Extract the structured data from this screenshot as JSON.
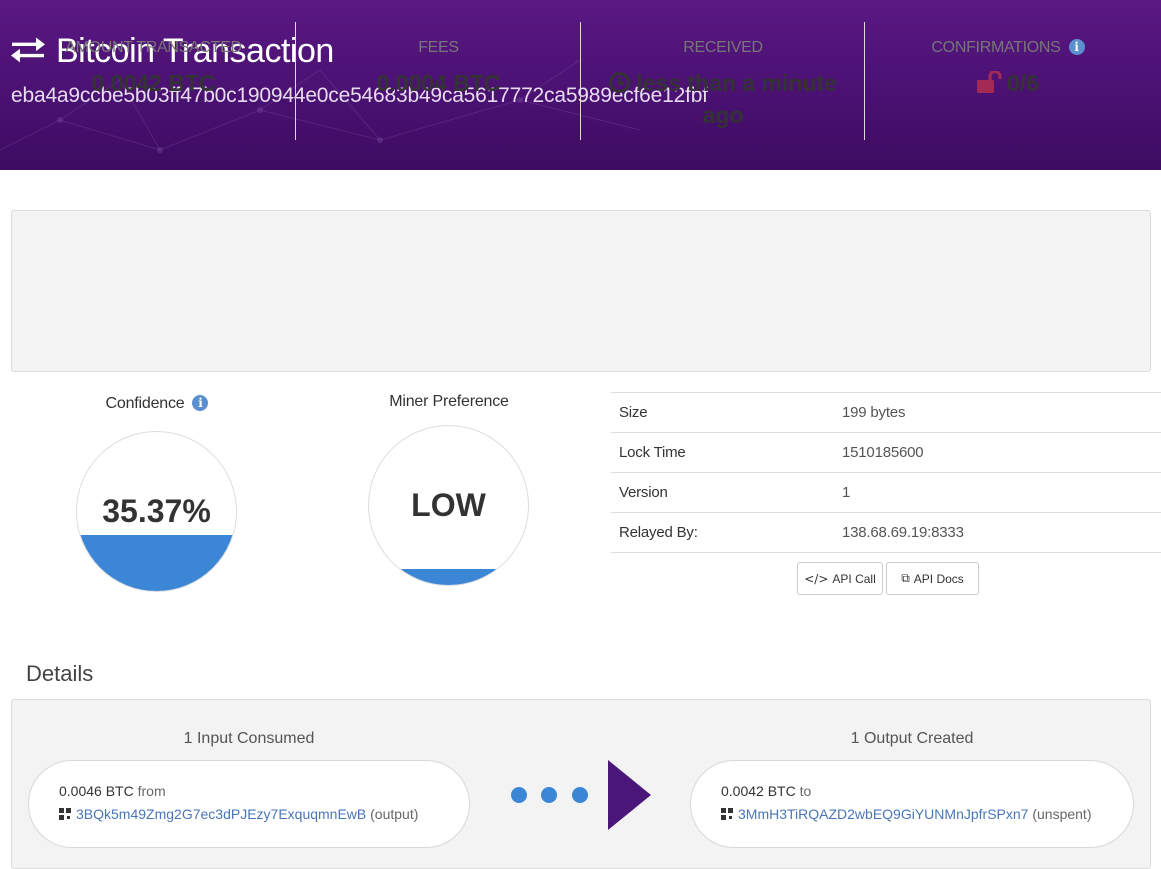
{
  "header": {
    "title": "Bitcoin Transaction",
    "hash": "eba4a9ccbe5b03ff47b0c190944e0ce54683b49ca5617772ca5989ecf6e12fbf"
  },
  "summary": {
    "amount_label": "AMOUNT TRANSACTED",
    "amount_value": "0.0042 BTC",
    "fees_label": "FEES",
    "fees_value": "0.0004 BTC",
    "received_label": "RECEIVED",
    "received_line1": "less than a minute",
    "received_line2": "ago",
    "confirmations_label": "CONFIRMATIONS",
    "confirmations_value": "0/6"
  },
  "gauges": {
    "confidence_label": "Confidence",
    "confidence_value": "35.37%",
    "confidence_fill": 0.3537,
    "miner_label": "Miner Preference",
    "miner_value": "LOW",
    "miner_fill": 0.1
  },
  "details_table": {
    "rows": [
      {
        "label": "Size",
        "value": "199 bytes"
      },
      {
        "label": "Lock Time",
        "value": "1510185600"
      },
      {
        "label": "Version",
        "value": "1"
      },
      {
        "label": "Relayed By:",
        "value": "138.68.69.19:8333"
      }
    ],
    "api_call_label": "API Call",
    "api_docs_label": "API Docs"
  },
  "details": {
    "heading": "Details",
    "inputs_title": "1 Input Consumed",
    "outputs_title": "1 Output Created",
    "input": {
      "amount": "0.0046 BTC",
      "direction": "from",
      "address": "3BQk5m49Zmg2G7ec3dPJEzy7ExquqmnEwB",
      "note": "(output)"
    },
    "output": {
      "amount": "0.0042 BTC",
      "direction": "to",
      "address": "3MmH3TiRQAZD2wbEQ9GiYUNMnJpfrSPxn7",
      "note": "(unspent)"
    }
  },
  "colors": {
    "header_bg": "#4a1172",
    "confirm_red": "#a32a55",
    "gauge_blue": "#3c86d6",
    "link_blue": "#4a76b8",
    "arrow_purple": "#4a1679"
  }
}
